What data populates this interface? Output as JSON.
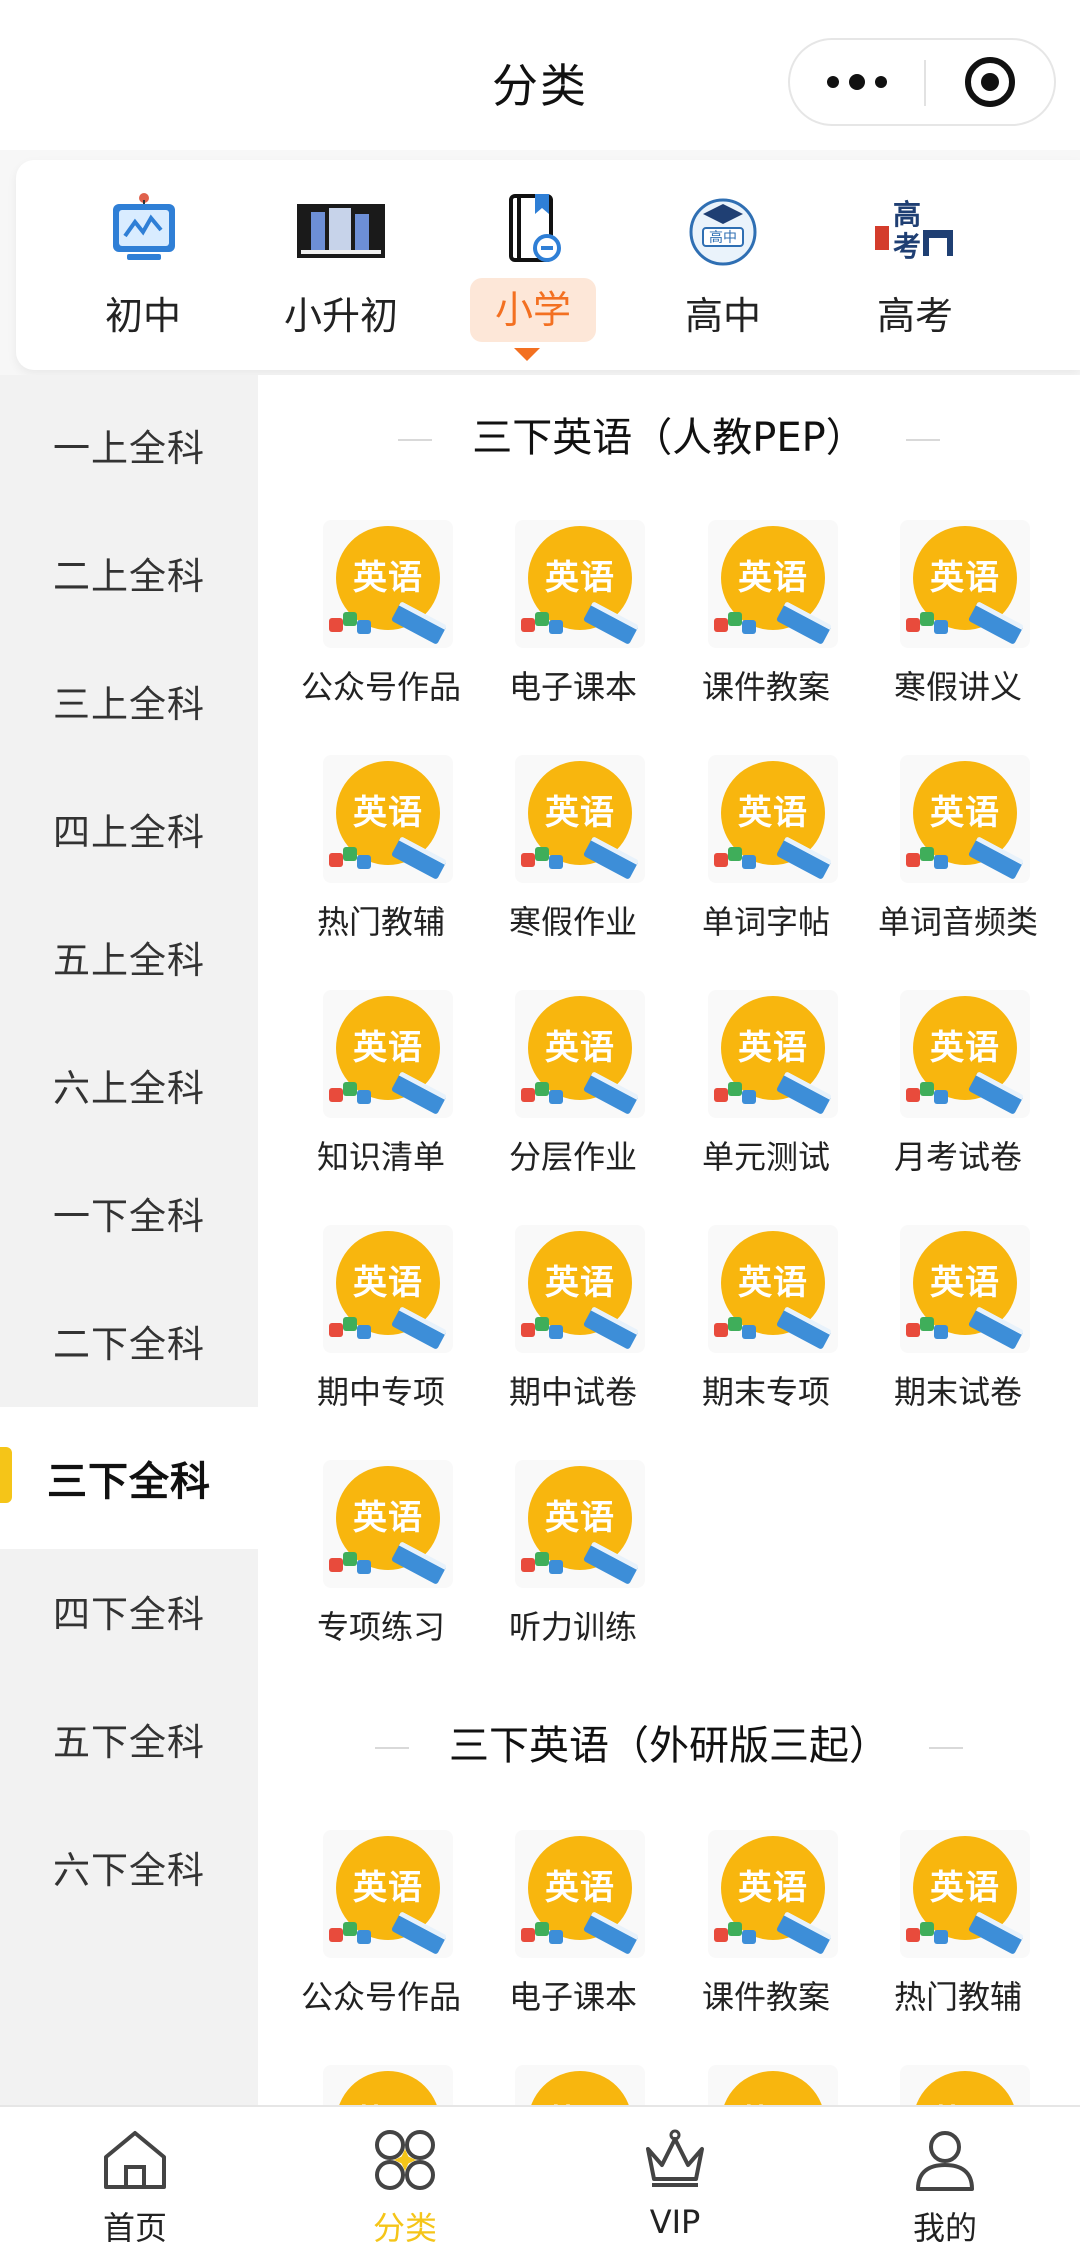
{
  "header": {
    "title": "分类"
  },
  "levels": [
    {
      "label": "初中",
      "icon": "tablet-chart-icon",
      "active": false
    },
    {
      "label": "小升初",
      "icon": "building-banner-icon",
      "active": false
    },
    {
      "label": "小学",
      "icon": "book-link-icon",
      "active": true
    },
    {
      "label": "高中",
      "icon": "graduation-badge-icon",
      "active": false
    },
    {
      "label": "高考",
      "icon": "gaokao-gate-icon",
      "active": false
    }
  ],
  "sidebar": {
    "items": [
      "一上全科",
      "二上全科",
      "三上全科",
      "四上全科",
      "五上全科",
      "六上全科",
      "一下全科",
      "二下全科",
      "三下全科",
      "四下全科",
      "五下全科",
      "六下全科"
    ],
    "active_index": 8
  },
  "sections": [
    {
      "title": "三下英语（人教PEP）",
      "items": [
        "公众号作品",
        "电子课本",
        "课件教案",
        "寒假讲义",
        "热门教辅",
        "寒假作业",
        "单词字帖",
        "单词音频类",
        "知识清单",
        "分层作业",
        "单元测试",
        "月考试卷",
        "期中专项",
        "期中试卷",
        "期末专项",
        "期末试卷",
        "专项练习",
        "听力训练"
      ]
    },
    {
      "title": "三下英语（外研版三起）",
      "items": [
        "公众号作品",
        "电子课本",
        "课件教案",
        "热门教辅"
      ]
    }
  ],
  "icon_text": "英语",
  "tabbar": [
    {
      "label": "首页",
      "icon": "home-icon",
      "active": false
    },
    {
      "label": "分类",
      "icon": "category-icon",
      "active": true
    },
    {
      "label": "VIP",
      "icon": "crown-icon",
      "active": false
    },
    {
      "label": "我的",
      "icon": "user-icon",
      "active": false
    }
  ],
  "colors": {
    "accent_yellow": "#f5c518",
    "active_level_text": "#f37021",
    "active_level_bg": "#fde7d8",
    "icon_sun": "#f8b60e"
  }
}
